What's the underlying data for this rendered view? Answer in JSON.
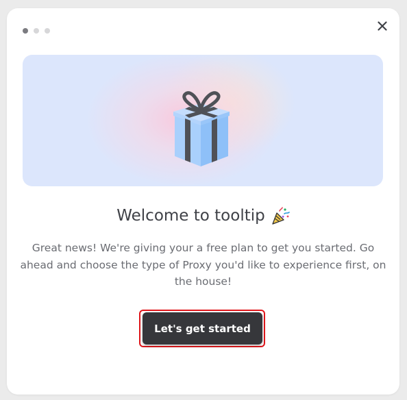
{
  "onboarding": {
    "step_total": 3,
    "step_current": 1,
    "title": "Welcome to tooltip",
    "description": "Great news! We're giving your a free plan to get you started. Go ahead and choose the type of Proxy you'd like to experience first, on the house!",
    "cta_label": "Let's get started"
  },
  "icons": {
    "close": "close-icon",
    "hero": "gift-icon",
    "title_emoji": "party-popper-icon"
  },
  "colors": {
    "cta_background": "#36373b",
    "cta_highlight": "#e0161b",
    "hero_background": "#dce6fc",
    "gift_box": "#9ec8fb",
    "gift_ribbon": "#4f5157"
  }
}
